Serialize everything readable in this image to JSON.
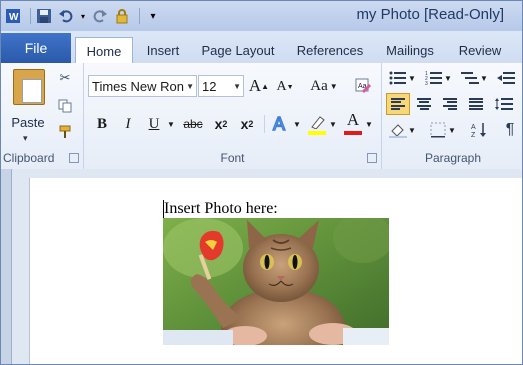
{
  "window": {
    "title": "my Photo [Read-Only]"
  },
  "qat": {
    "icons": [
      "word-app-icon",
      "save-icon",
      "undo-icon",
      "redo-icon",
      "lock-icon",
      "customize-icon"
    ]
  },
  "tabs": [
    {
      "label": "File"
    },
    {
      "label": "Home"
    },
    {
      "label": "Insert"
    },
    {
      "label": "Page Layout"
    },
    {
      "label": "References"
    },
    {
      "label": "Mailings"
    },
    {
      "label": "Review"
    }
  ],
  "clipboard": {
    "paste_label": "Paste",
    "group_label": "Clipboard"
  },
  "font": {
    "name": "Times New Roman",
    "name_visible": "Times New Ron",
    "size": "12",
    "group_label": "Font",
    "bold": "B",
    "italic": "I",
    "underline": "U",
    "strike": "abc",
    "grow": "A",
    "shrink": "A",
    "case": "Aa",
    "highlight_color": "#ffff00",
    "font_color": "#e01b1b"
  },
  "paragraph": {
    "group_label": "Paragraph"
  },
  "document": {
    "text": "Insert Photo here:"
  },
  "colors": {
    "accent": "#2a59a9",
    "ribbon_bg": "#e6edf8",
    "active_button": "#f7d77a"
  }
}
